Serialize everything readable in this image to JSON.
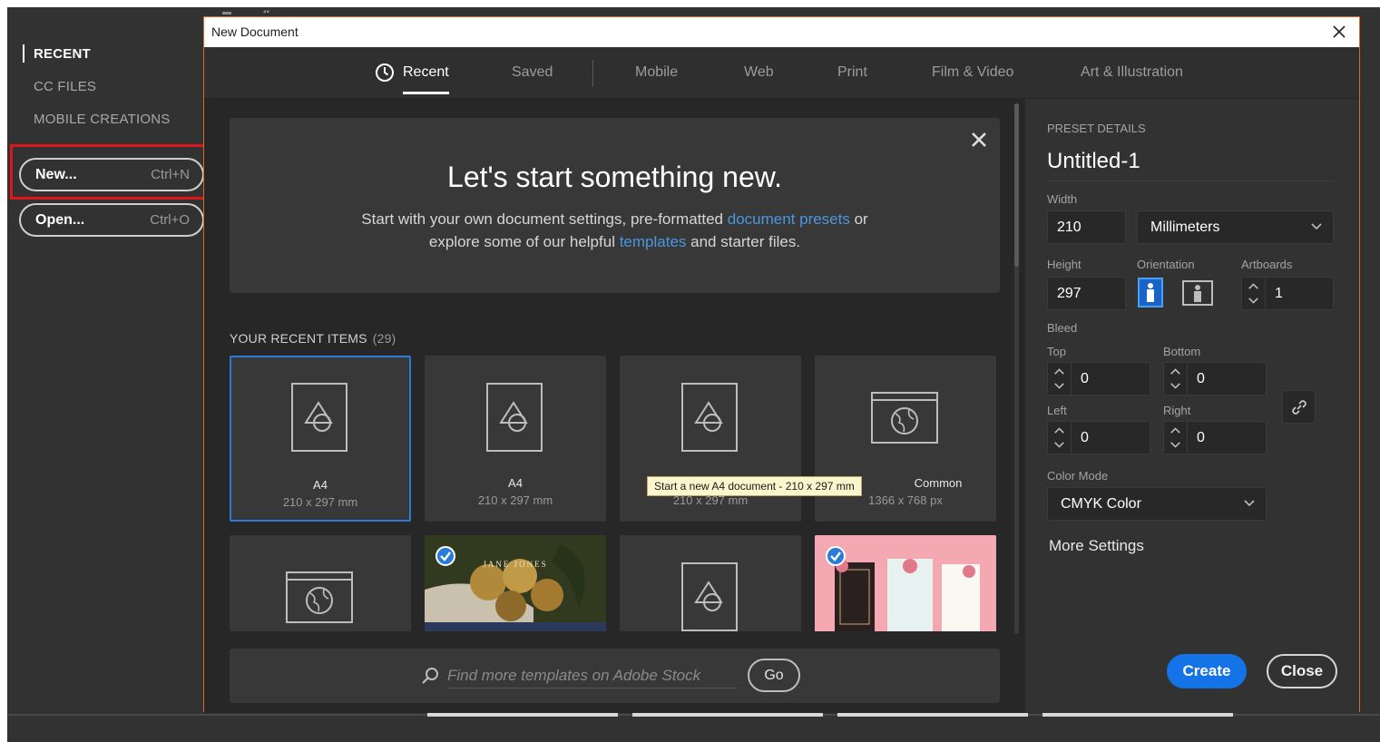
{
  "home": {
    "nav": [
      {
        "label": "RECENT",
        "active": true
      },
      {
        "label": "CC FILES",
        "active": false
      },
      {
        "label": "MOBILE CREATIONS",
        "active": false
      }
    ],
    "new_button": {
      "label": "New...",
      "shortcut": "Ctrl+N"
    },
    "open_button": {
      "label": "Open...",
      "shortcut": "Ctrl+O"
    }
  },
  "dialog": {
    "title": "New Document",
    "tabs": [
      {
        "label": "Recent",
        "icon": "clock-icon",
        "active": true
      },
      {
        "label": "Saved",
        "active": false
      },
      {
        "label": "Mobile",
        "active": false
      },
      {
        "label": "Web",
        "active": false
      },
      {
        "label": "Print",
        "active": false
      },
      {
        "label": "Film & Video",
        "active": false
      },
      {
        "label": "Art & Illustration",
        "active": false
      }
    ],
    "hero": {
      "title": "Let's start something new.",
      "line1_prefix": "Start with your own document settings, pre-formatted ",
      "line1_link": "document presets",
      "line1_suffix": " or",
      "line2_prefix": "explore some of our helpful ",
      "line2_link": "templates",
      "line2_suffix": " and starter files."
    },
    "recent": {
      "heading": "YOUR RECENT ITEMS",
      "count": "(29)",
      "items": [
        {
          "name": "A4",
          "size": "210 x 297 mm",
          "icon": "artboard-shapes-icon",
          "selected": true
        },
        {
          "name": "A4",
          "size": "210 x 297 mm",
          "icon": "artboard-shapes-icon",
          "selected": false
        },
        {
          "name": "",
          "size": "210 x 297 mm",
          "icon": "artboard-shapes-icon",
          "selected": false
        },
        {
          "name": "Common",
          "size": "1366 x 768 px",
          "icon": "web-globe-icon",
          "selected": false
        },
        {
          "name": "",
          "size": "",
          "icon": "web-globe-icon",
          "selected": false
        },
        {
          "name": "",
          "size": "",
          "icon": "template-thumbnail",
          "thumb_text": "JANE JONES",
          "selected": false
        },
        {
          "name": "",
          "size": "",
          "icon": "artboard-shapes-icon",
          "selected": false
        },
        {
          "name": "",
          "size": "",
          "icon": "template-thumbnail",
          "selected": false
        }
      ],
      "tooltip": "Start a new A4 document - 210 x 297 mm"
    },
    "search": {
      "placeholder": "Find more templates on Adobe Stock",
      "value": "",
      "go_label": "Go"
    }
  },
  "preset": {
    "heading": "PRESET DETAILS",
    "name": "Untitled-1",
    "width_label": "Width",
    "width": "210",
    "unit": "Millimeters",
    "height_label": "Height",
    "height": "297",
    "orientation_label": "Orientation",
    "orientation": "portrait",
    "artboards_label": "Artboards",
    "artboards": "1",
    "bleed_label": "Bleed",
    "top_label": "Top",
    "top": "0",
    "bottom_label": "Bottom",
    "bottom": "0",
    "left_label": "Left",
    "left": "0",
    "right_label": "Right",
    "right": "0",
    "color_mode_label": "Color Mode",
    "color_mode": "CMYK Color",
    "more_settings": "More Settings",
    "create_label": "Create",
    "close_label": "Close"
  },
  "colors": {
    "accent": "#1473e6",
    "selection": "#2a7bd8",
    "link": "#4a97e0",
    "highlight": "#e0161b"
  }
}
